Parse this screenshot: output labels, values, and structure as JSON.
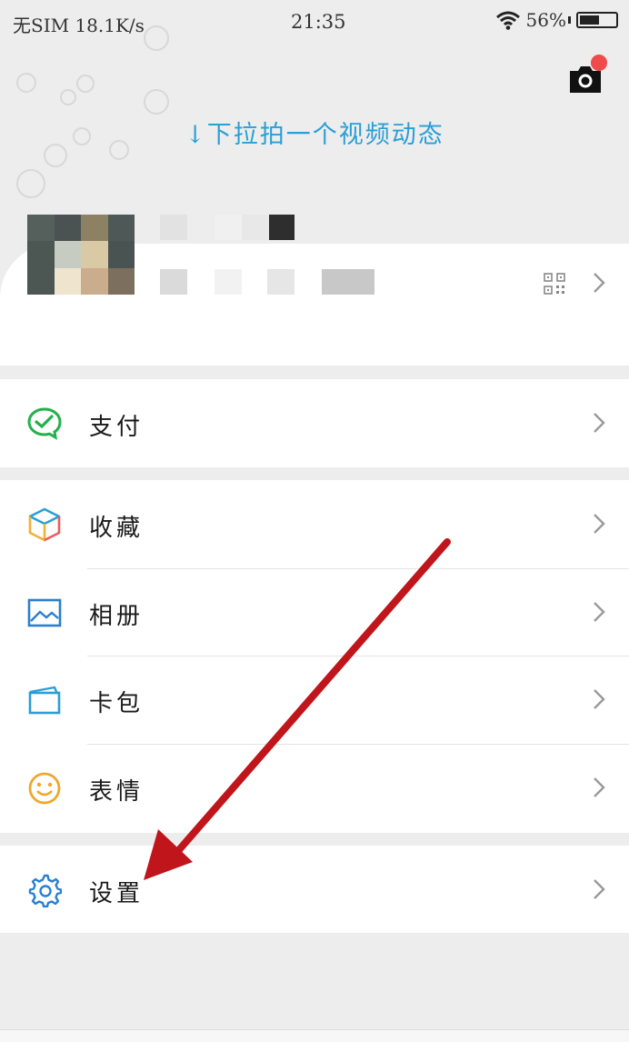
{
  "status_bar": {
    "carrier": "无SIM",
    "speed": "18.1K/s",
    "time": "21:35",
    "battery": "56%",
    "battery_level": 0.56
  },
  "header": {
    "pull_hint": "↓下拉拍一个视频动态",
    "camera_icon": "camera-icon"
  },
  "profile": {
    "qr_icon": "qr-code-icon",
    "chevron_icon": "chevron-right-icon"
  },
  "menu": {
    "pay": {
      "label": "支付",
      "icon": "wechat-pay-icon"
    },
    "favorites": {
      "label": "收藏",
      "icon": "cube-icon"
    },
    "album": {
      "label": "相册",
      "icon": "picture-icon"
    },
    "cards": {
      "label": "卡包",
      "icon": "wallet-icon"
    },
    "stickers": {
      "label": "表情",
      "icon": "smiley-icon"
    },
    "settings": {
      "label": "设置",
      "icon": "gear-icon"
    }
  },
  "colors": {
    "accent_blue": "#2a9fd6",
    "pay_green": "#22b14c",
    "annotation_red": "#c0151b",
    "notification_red": "#f04a4a"
  }
}
